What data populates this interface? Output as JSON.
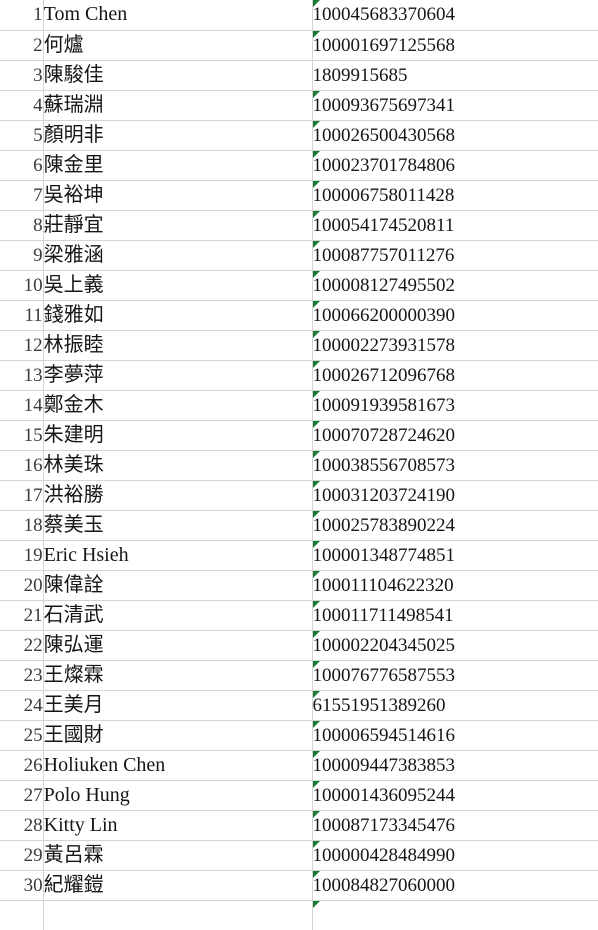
{
  "app": {
    "type": "spreadsheet",
    "gridline_color": "#d4d4d4",
    "background_color": "#ffffff",
    "error_marker_color": "#1a7a32",
    "error_marker_name": "number-stored-as-text-indicator"
  },
  "columns": [
    {
      "key": "rownum",
      "name": "row-number-gutter"
    },
    {
      "key": "name",
      "name": "name-column"
    },
    {
      "key": "id",
      "name": "id-column"
    }
  ],
  "rows": [
    {
      "n": "1",
      "name": "Tom Chen",
      "id": "100045683370604",
      "flag": true
    },
    {
      "n": "2",
      "name": "何爐",
      "id": "100001697125568",
      "flag": true
    },
    {
      "n": "3",
      "name": "陳駿佳",
      "id": "1809915685",
      "flag": false
    },
    {
      "n": "4",
      "name": "蘇瑞淵",
      "id": "100093675697341",
      "flag": true
    },
    {
      "n": "5",
      "name": "顏明非",
      "id": "100026500430568",
      "flag": true
    },
    {
      "n": "6",
      "name": "陳金里",
      "id": "100023701784806",
      "flag": true
    },
    {
      "n": "7",
      "name": "吳裕坤",
      "id": "100006758011428",
      "flag": true
    },
    {
      "n": "8",
      "name": "莊靜宜",
      "id": "100054174520811",
      "flag": true
    },
    {
      "n": "9",
      "name": "梁雅涵",
      "id": "100087757011276",
      "flag": true
    },
    {
      "n": "10",
      "name": "吳上義",
      "id": "100008127495502",
      "flag": true
    },
    {
      "n": "11",
      "name": "錢雅如",
      "id": "100066200000390",
      "flag": true
    },
    {
      "n": "12",
      "name": "林振睦",
      "id": "100002273931578",
      "flag": true
    },
    {
      "n": "13",
      "name": "李夢萍",
      "id": "100026712096768",
      "flag": true
    },
    {
      "n": "14",
      "name": "鄭金木",
      "id": "100091939581673",
      "flag": true
    },
    {
      "n": "15",
      "name": "朱建明",
      "id": "100070728724620",
      "flag": true
    },
    {
      "n": "16",
      "name": "林美珠",
      "id": "100038556708573",
      "flag": true
    },
    {
      "n": "17",
      "name": "洪裕勝",
      "id": "100031203724190",
      "flag": true
    },
    {
      "n": "18",
      "name": "蔡美玉",
      "id": "100025783890224",
      "flag": true
    },
    {
      "n": "19",
      "name": "Eric Hsieh",
      "id": "100001348774851",
      "flag": true
    },
    {
      "n": "20",
      "name": "陳偉詮",
      "id": "100011104622320",
      "flag": true
    },
    {
      "n": "21",
      "name": "石清武",
      "id": "100011711498541",
      "flag": true
    },
    {
      "n": "22",
      "name": "陳弘運",
      "id": "100002204345025",
      "flag": true
    },
    {
      "n": "23",
      "name": "王燦霖",
      "id": "100076776587553",
      "flag": true
    },
    {
      "n": "24",
      "name": "王美月",
      "id": "61551951389260",
      "flag": true
    },
    {
      "n": "25",
      "name": "王國財",
      "id": "100006594514616",
      "flag": true
    },
    {
      "n": "26",
      "name": "Holiuken Chen",
      "id": "100009447383853",
      "flag": true
    },
    {
      "n": "27",
      "name": "Polo Hung",
      "id": "100001436095244",
      "flag": true
    },
    {
      "n": "28",
      "name": "Kitty Lin",
      "id": "100087173345476",
      "flag": true
    },
    {
      "n": "29",
      "name": "黃呂霖",
      "id": "100000428484990",
      "flag": true
    },
    {
      "n": "30",
      "name": "紀耀鎧",
      "id": "100084827060000",
      "flag": true
    }
  ],
  "partial_row": {
    "n": "",
    "name": "",
    "id": "",
    "flag": true
  }
}
